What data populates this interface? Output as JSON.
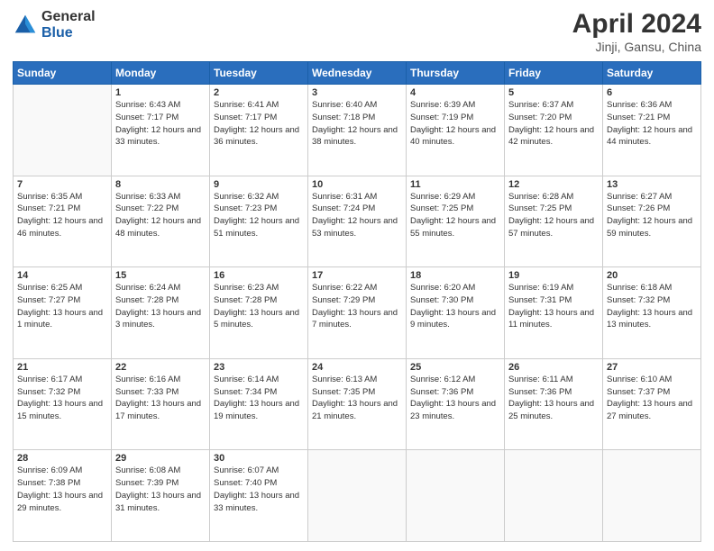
{
  "header": {
    "logo_general": "General",
    "logo_blue": "Blue",
    "title": "April 2024",
    "subtitle": "Jinji, Gansu, China"
  },
  "weekdays": [
    "Sunday",
    "Monday",
    "Tuesday",
    "Wednesday",
    "Thursday",
    "Friday",
    "Saturday"
  ],
  "weeks": [
    [
      {
        "day": "",
        "sunrise": "",
        "sunset": "",
        "daylight": ""
      },
      {
        "day": "1",
        "sunrise": "Sunrise: 6:43 AM",
        "sunset": "Sunset: 7:17 PM",
        "daylight": "Daylight: 12 hours and 33 minutes."
      },
      {
        "day": "2",
        "sunrise": "Sunrise: 6:41 AM",
        "sunset": "Sunset: 7:17 PM",
        "daylight": "Daylight: 12 hours and 36 minutes."
      },
      {
        "day": "3",
        "sunrise": "Sunrise: 6:40 AM",
        "sunset": "Sunset: 7:18 PM",
        "daylight": "Daylight: 12 hours and 38 minutes."
      },
      {
        "day": "4",
        "sunrise": "Sunrise: 6:39 AM",
        "sunset": "Sunset: 7:19 PM",
        "daylight": "Daylight: 12 hours and 40 minutes."
      },
      {
        "day": "5",
        "sunrise": "Sunrise: 6:37 AM",
        "sunset": "Sunset: 7:20 PM",
        "daylight": "Daylight: 12 hours and 42 minutes."
      },
      {
        "day": "6",
        "sunrise": "Sunrise: 6:36 AM",
        "sunset": "Sunset: 7:21 PM",
        "daylight": "Daylight: 12 hours and 44 minutes."
      }
    ],
    [
      {
        "day": "7",
        "sunrise": "Sunrise: 6:35 AM",
        "sunset": "Sunset: 7:21 PM",
        "daylight": "Daylight: 12 hours and 46 minutes."
      },
      {
        "day": "8",
        "sunrise": "Sunrise: 6:33 AM",
        "sunset": "Sunset: 7:22 PM",
        "daylight": "Daylight: 12 hours and 48 minutes."
      },
      {
        "day": "9",
        "sunrise": "Sunrise: 6:32 AM",
        "sunset": "Sunset: 7:23 PM",
        "daylight": "Daylight: 12 hours and 51 minutes."
      },
      {
        "day": "10",
        "sunrise": "Sunrise: 6:31 AM",
        "sunset": "Sunset: 7:24 PM",
        "daylight": "Daylight: 12 hours and 53 minutes."
      },
      {
        "day": "11",
        "sunrise": "Sunrise: 6:29 AM",
        "sunset": "Sunset: 7:25 PM",
        "daylight": "Daylight: 12 hours and 55 minutes."
      },
      {
        "day": "12",
        "sunrise": "Sunrise: 6:28 AM",
        "sunset": "Sunset: 7:25 PM",
        "daylight": "Daylight: 12 hours and 57 minutes."
      },
      {
        "day": "13",
        "sunrise": "Sunrise: 6:27 AM",
        "sunset": "Sunset: 7:26 PM",
        "daylight": "Daylight: 12 hours and 59 minutes."
      }
    ],
    [
      {
        "day": "14",
        "sunrise": "Sunrise: 6:25 AM",
        "sunset": "Sunset: 7:27 PM",
        "daylight": "Daylight: 13 hours and 1 minute."
      },
      {
        "day": "15",
        "sunrise": "Sunrise: 6:24 AM",
        "sunset": "Sunset: 7:28 PM",
        "daylight": "Daylight: 13 hours and 3 minutes."
      },
      {
        "day": "16",
        "sunrise": "Sunrise: 6:23 AM",
        "sunset": "Sunset: 7:28 PM",
        "daylight": "Daylight: 13 hours and 5 minutes."
      },
      {
        "day": "17",
        "sunrise": "Sunrise: 6:22 AM",
        "sunset": "Sunset: 7:29 PM",
        "daylight": "Daylight: 13 hours and 7 minutes."
      },
      {
        "day": "18",
        "sunrise": "Sunrise: 6:20 AM",
        "sunset": "Sunset: 7:30 PM",
        "daylight": "Daylight: 13 hours and 9 minutes."
      },
      {
        "day": "19",
        "sunrise": "Sunrise: 6:19 AM",
        "sunset": "Sunset: 7:31 PM",
        "daylight": "Daylight: 13 hours and 11 minutes."
      },
      {
        "day": "20",
        "sunrise": "Sunrise: 6:18 AM",
        "sunset": "Sunset: 7:32 PM",
        "daylight": "Daylight: 13 hours and 13 minutes."
      }
    ],
    [
      {
        "day": "21",
        "sunrise": "Sunrise: 6:17 AM",
        "sunset": "Sunset: 7:32 PM",
        "daylight": "Daylight: 13 hours and 15 minutes."
      },
      {
        "day": "22",
        "sunrise": "Sunrise: 6:16 AM",
        "sunset": "Sunset: 7:33 PM",
        "daylight": "Daylight: 13 hours and 17 minutes."
      },
      {
        "day": "23",
        "sunrise": "Sunrise: 6:14 AM",
        "sunset": "Sunset: 7:34 PM",
        "daylight": "Daylight: 13 hours and 19 minutes."
      },
      {
        "day": "24",
        "sunrise": "Sunrise: 6:13 AM",
        "sunset": "Sunset: 7:35 PM",
        "daylight": "Daylight: 13 hours and 21 minutes."
      },
      {
        "day": "25",
        "sunrise": "Sunrise: 6:12 AM",
        "sunset": "Sunset: 7:36 PM",
        "daylight": "Daylight: 13 hours and 23 minutes."
      },
      {
        "day": "26",
        "sunrise": "Sunrise: 6:11 AM",
        "sunset": "Sunset: 7:36 PM",
        "daylight": "Daylight: 13 hours and 25 minutes."
      },
      {
        "day": "27",
        "sunrise": "Sunrise: 6:10 AM",
        "sunset": "Sunset: 7:37 PM",
        "daylight": "Daylight: 13 hours and 27 minutes."
      }
    ],
    [
      {
        "day": "28",
        "sunrise": "Sunrise: 6:09 AM",
        "sunset": "Sunset: 7:38 PM",
        "daylight": "Daylight: 13 hours and 29 minutes."
      },
      {
        "day": "29",
        "sunrise": "Sunrise: 6:08 AM",
        "sunset": "Sunset: 7:39 PM",
        "daylight": "Daylight: 13 hours and 31 minutes."
      },
      {
        "day": "30",
        "sunrise": "Sunrise: 6:07 AM",
        "sunset": "Sunset: 7:40 PM",
        "daylight": "Daylight: 13 hours and 33 minutes."
      },
      {
        "day": "",
        "sunrise": "",
        "sunset": "",
        "daylight": ""
      },
      {
        "day": "",
        "sunrise": "",
        "sunset": "",
        "daylight": ""
      },
      {
        "day": "",
        "sunrise": "",
        "sunset": "",
        "daylight": ""
      },
      {
        "day": "",
        "sunrise": "",
        "sunset": "",
        "daylight": ""
      }
    ]
  ]
}
